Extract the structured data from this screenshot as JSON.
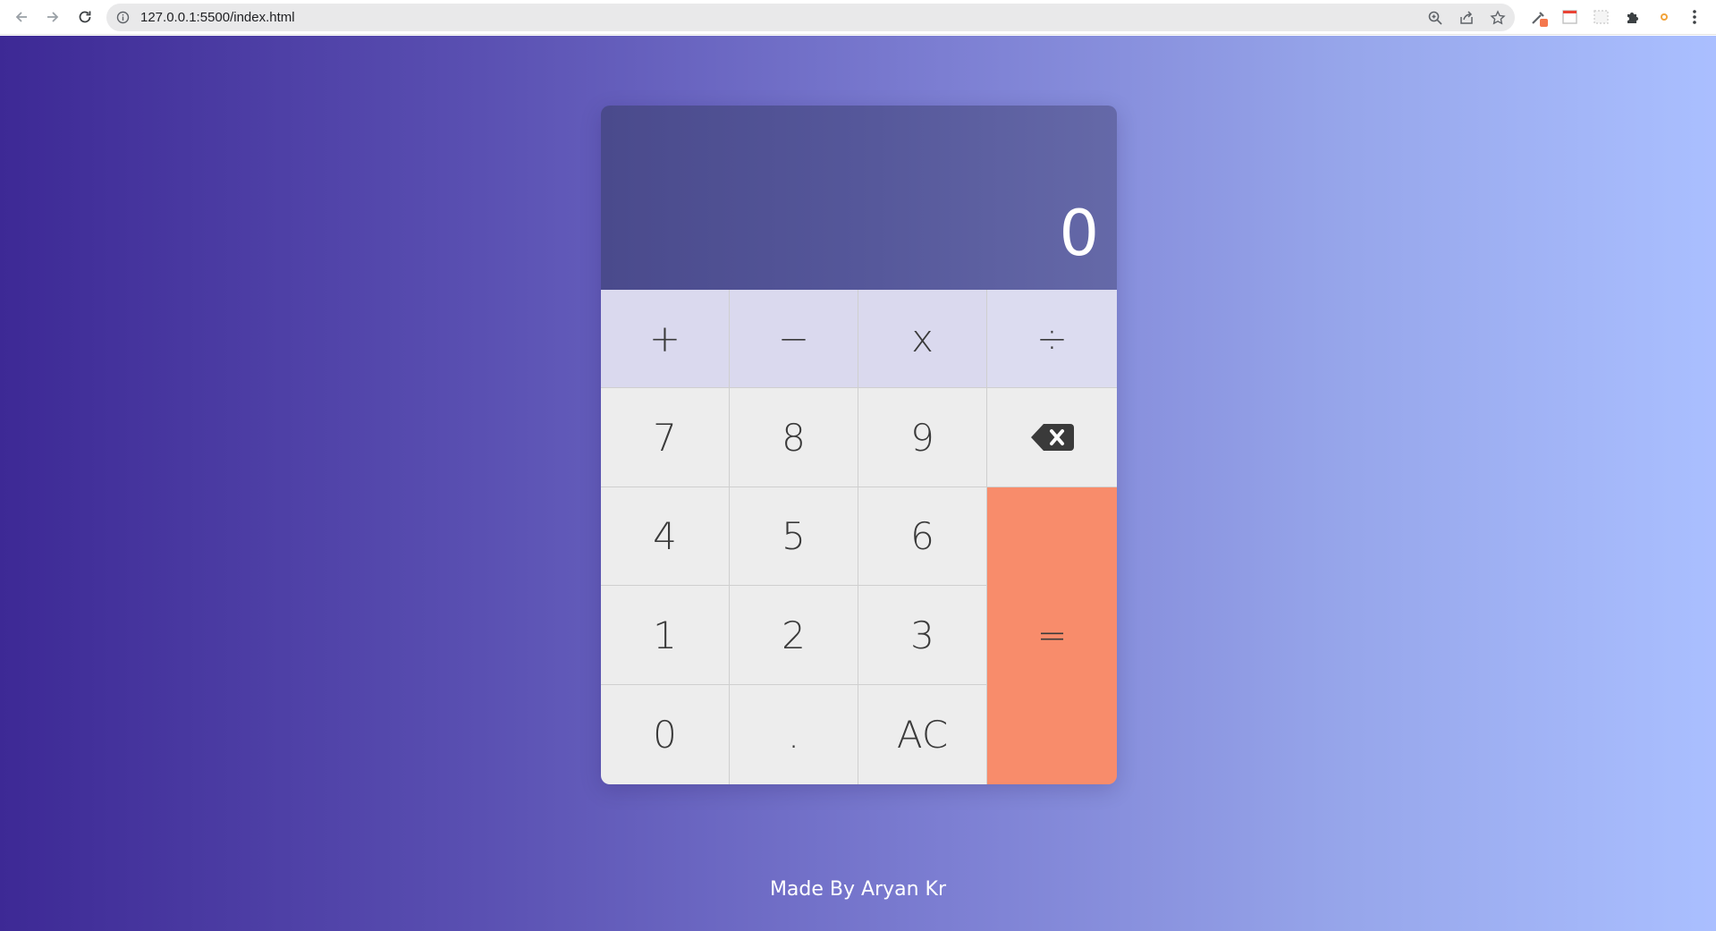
{
  "browser": {
    "url": "127.0.0.1:5500/index.html"
  },
  "calculator": {
    "display": "0",
    "operators": [
      "+",
      "−",
      "x",
      "÷"
    ],
    "row1": [
      "7",
      "8",
      "9"
    ],
    "row2": [
      "4",
      "5",
      "6"
    ],
    "row3": [
      "1",
      "2",
      "3"
    ],
    "row4": [
      "0",
      ".",
      "AC"
    ],
    "equals": "="
  },
  "footer": {
    "credit": "Made By Aryan Kr"
  },
  "colors": {
    "equals_button": "#f88c6b",
    "operator_button": "#dad9ee",
    "digit_button": "#ededed",
    "display_bg": "#55579a"
  },
  "icons": {
    "backspace": "backspace-icon"
  }
}
